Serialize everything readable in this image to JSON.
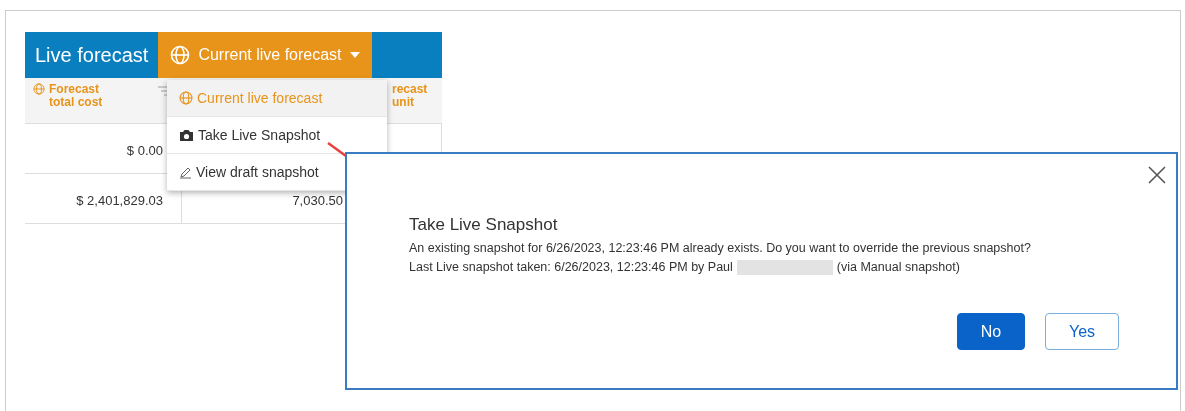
{
  "panel": {
    "title": "Live forecast",
    "dropdown": {
      "label": "Current live forecast",
      "expanded": true
    }
  },
  "table": {
    "columns": {
      "column_1": "Forecast total cost",
      "column_3": "recast unit"
    },
    "rows": [
      {
        "column_1": "$ 0.00"
      },
      {
        "column_1": "$ 2,401,829.03",
        "column_2": "7,030.50"
      }
    ]
  },
  "menu": {
    "items": [
      {
        "label": "Current live forecast",
        "kind": "globe",
        "selected": true
      },
      {
        "label": "Take Live Snapshot",
        "kind": "camera",
        "selected": false
      },
      {
        "label": "View draft snapshot",
        "kind": "pencil",
        "selected": false
      }
    ]
  },
  "dialog": {
    "title": "Take Live Snapshot",
    "message": "An existing snapshot for 6/26/2023, 12:23:46 PM already exists. Do you want to override the previous snapshot?",
    "detail_before": "Last Live snapshot taken: 6/26/2023, 12:23:46 PM by Paul",
    "detail_after": "(via Manual snapshot)",
    "buttons": [
      {
        "label": "No",
        "kind": "primary"
      },
      {
        "label": "Yes",
        "kind": "outline"
      }
    ]
  }
}
